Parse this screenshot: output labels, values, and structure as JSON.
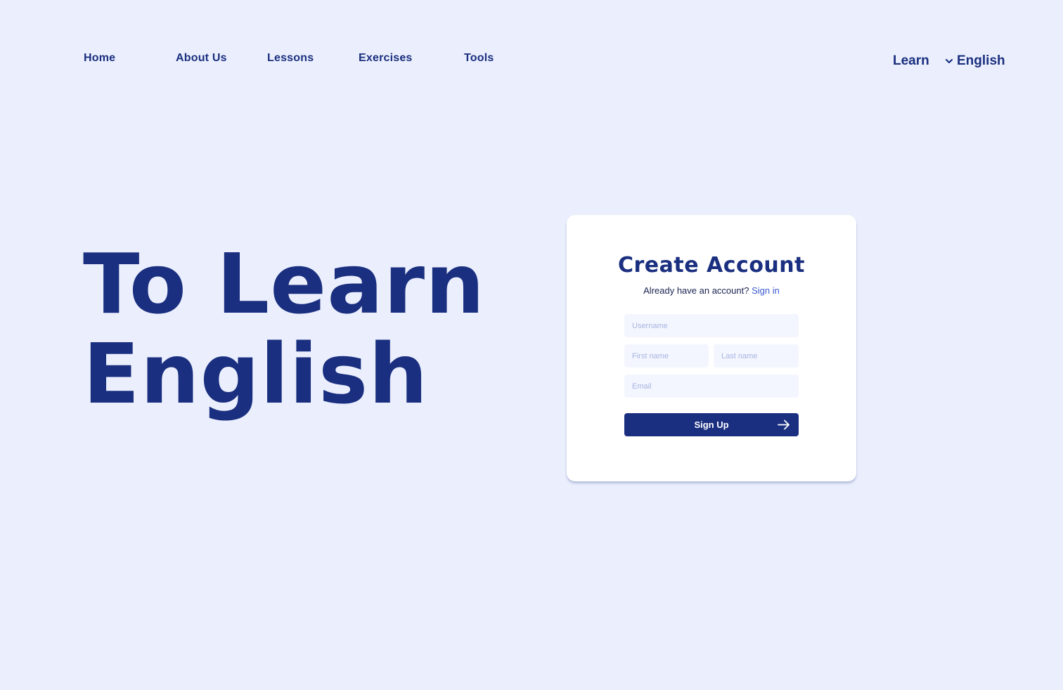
{
  "nav": {
    "items": [
      {
        "label": "Home"
      },
      {
        "label": "About Us"
      },
      {
        "label": "Lessons"
      },
      {
        "label": "Exercises"
      },
      {
        "label": "Tools"
      }
    ]
  },
  "header": {
    "learn_label": "Learn",
    "language": {
      "selected": "English",
      "icon": "chevron-down-icon"
    }
  },
  "hero": {
    "line1": "To Learn",
    "line2": "English"
  },
  "signup_form": {
    "title": "Create Account",
    "subtitle": "Already have an account?",
    "signin_link": "Sign in",
    "username": {
      "value": "",
      "placeholder": "Username"
    },
    "first_name": {
      "value": "",
      "placeholder": "First name"
    },
    "last_name": {
      "value": "",
      "placeholder": "Last name"
    },
    "email": {
      "value": "",
      "placeholder": "Email"
    },
    "submit_label": "Sign Up",
    "submit_icon": "arrow-right-icon"
  },
  "colors": {
    "background": "#ebeffd",
    "primary": "#1a2f7f",
    "card": "#ffffff",
    "input_bg": "#f3f6ff",
    "link": "#3a5bd0"
  }
}
